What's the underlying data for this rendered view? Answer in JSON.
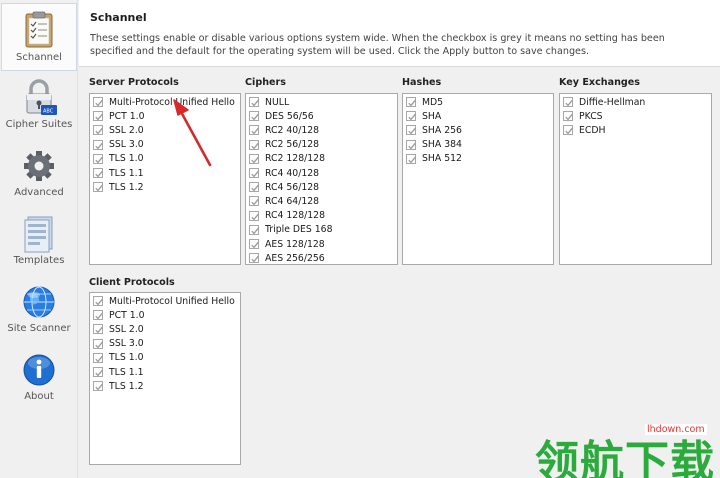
{
  "sidebar": {
    "items": [
      {
        "label": "Schannel",
        "icon": "clipboard-icon"
      },
      {
        "label": "Cipher Suites",
        "icon": "lock-icon"
      },
      {
        "label": "Advanced",
        "icon": "gear-icon"
      },
      {
        "label": "Templates",
        "icon": "template-icon"
      },
      {
        "label": "Site Scanner",
        "icon": "globe-icon"
      },
      {
        "label": "About",
        "icon": "info-icon"
      }
    ],
    "active": "Schannel"
  },
  "header": {
    "title": "Schannel",
    "description": "These settings enable or disable various options system wide. When the checkbox is grey it means no setting has been specified and the default for the operating system will be used. Click the Apply button to save changes."
  },
  "server_protocols": {
    "label": "Server Protocols",
    "items": [
      "Multi-Protocol Unified Hello",
      "PCT 1.0",
      "SSL 2.0",
      "SSL 3.0",
      "TLS 1.0",
      "TLS 1.1",
      "TLS 1.2"
    ]
  },
  "ciphers": {
    "label": "Ciphers",
    "items": [
      "NULL",
      "DES 56/56",
      "RC2 40/128",
      "RC2 56/128",
      "RC2 128/128",
      "RC4 40/128",
      "RC4 56/128",
      "RC4 64/128",
      "RC4 128/128",
      "Triple DES 168",
      "AES 128/128",
      "AES 256/256"
    ]
  },
  "hashes": {
    "label": "Hashes",
    "items": [
      "MD5",
      "SHA",
      "SHA 256",
      "SHA 384",
      "SHA 512"
    ]
  },
  "key_exchanges": {
    "label": "Key Exchanges",
    "items": [
      "Diffie-Hellman",
      "PKCS",
      "ECDH"
    ]
  },
  "client_protocols": {
    "label": "Client Protocols",
    "items": [
      "Multi-Protocol Unified Hello",
      "PCT 1.0",
      "SSL 2.0",
      "SSL 3.0",
      "TLS 1.0",
      "TLS 1.1",
      "TLS 1.2"
    ]
  },
  "checkbox_state": "grey-checked",
  "watermark": {
    "text": "领航下载",
    "url": "lhdown.com"
  },
  "colors": {
    "arrow": "#d62a2a",
    "watermark": "#2bab3c",
    "active_nav_border": "#cfd8e6"
  }
}
